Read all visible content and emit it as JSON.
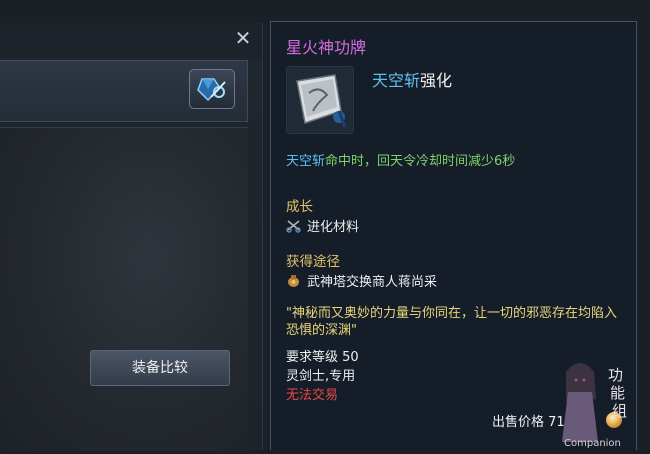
{
  "left_window": {
    "close_icon": "close-icon",
    "gem_icon": "gem-icon",
    "compare_label": "装备比较"
  },
  "tooltip": {
    "item_name": "星火神功牌",
    "item_name_color": "#d36ce0",
    "enhance": {
      "skill": "天空斩",
      "suffix": "强化"
    },
    "effect": {
      "skill": "天空斩",
      "text": "命中时，回天令冷却时间减少6秒"
    },
    "growth": {
      "title": "成长",
      "item": "进化材料",
      "icon": "scissors-icon"
    },
    "source": {
      "title": "获得途径",
      "item": "武神塔交换商人蒋尚采",
      "icon": "pouch-icon"
    },
    "flavor": "\"神秘而又奥妙的力量与你同在，让一切的邪恶存在均陷入恐惧的深渊\"",
    "level_req": "要求等级 50",
    "class_req": "灵剑士,专用",
    "trade": "无法交易",
    "price_label": "出售价格 7",
    "price_tail": "1",
    "price_tail2": "3",
    "coin_icon": "coin-icon"
  },
  "watermark": {
    "text": "Companion",
    "glyphs": "功能组"
  },
  "colors": {
    "skill": "#5cc1f2",
    "effect": "#7fd36a",
    "section": "#e3c36b",
    "flavor": "#e6d67a",
    "trade": "#e84a43"
  }
}
